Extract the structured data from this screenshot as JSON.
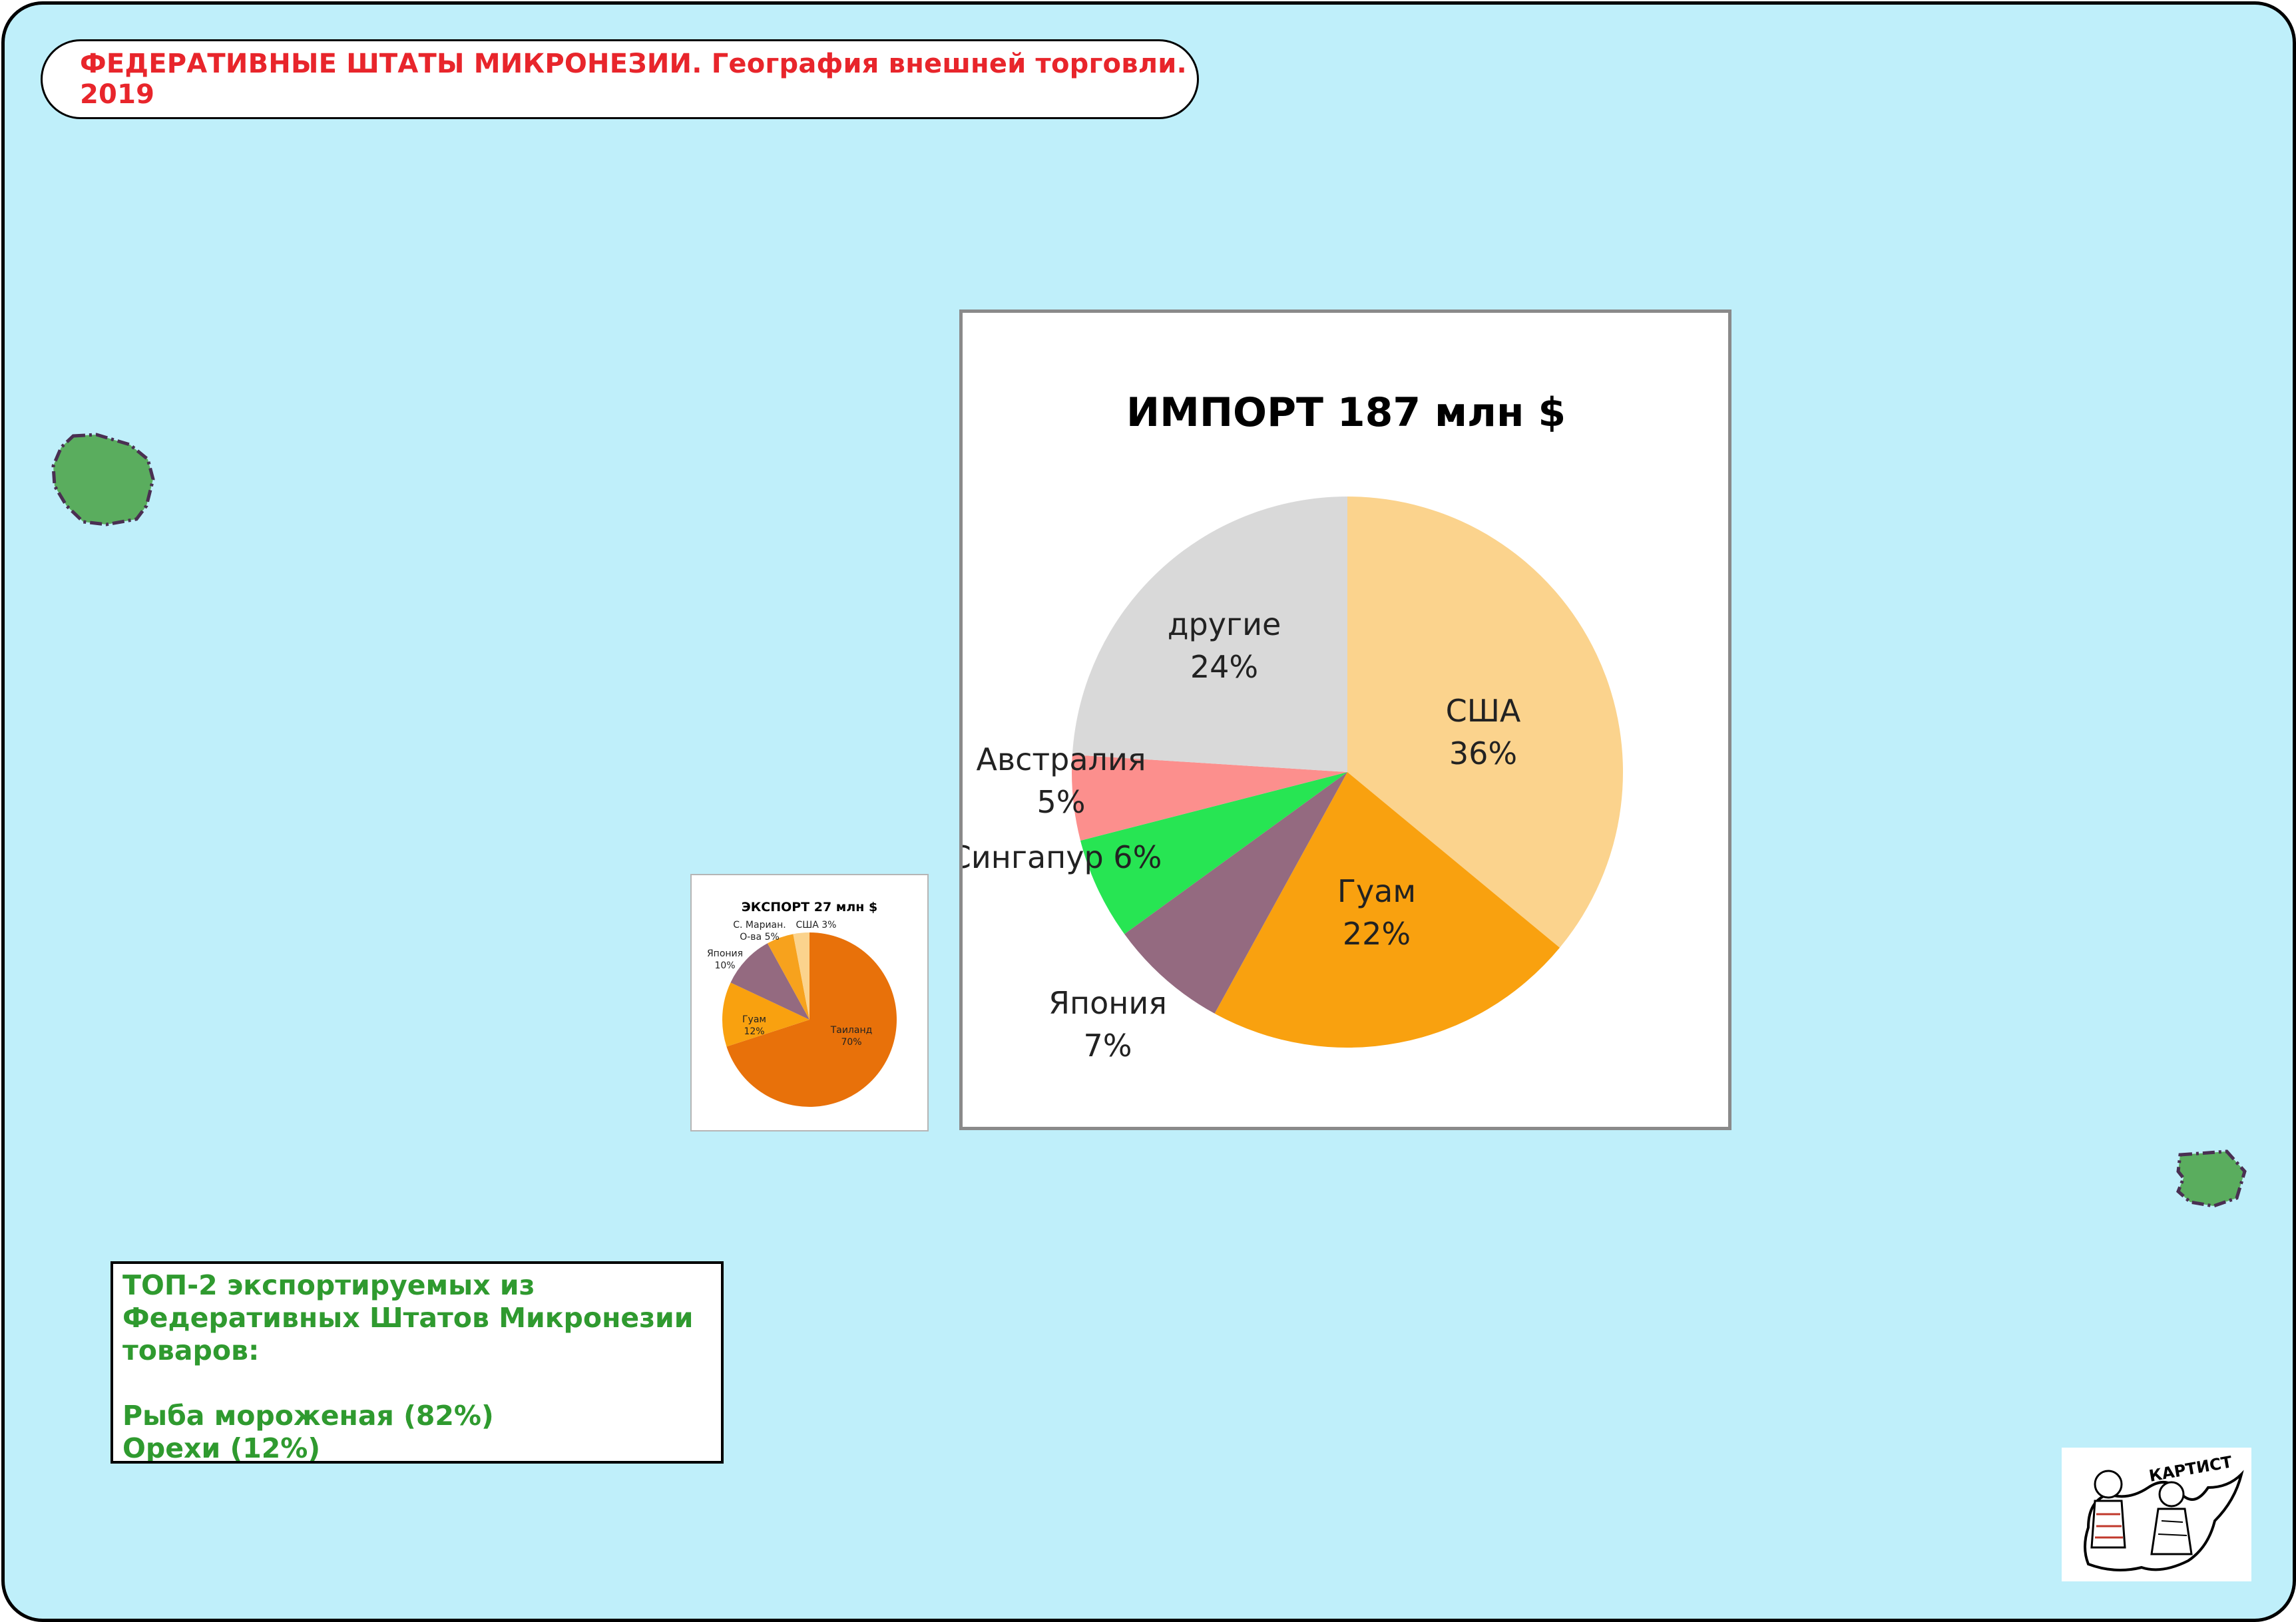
{
  "map_title": "ФЕДЕРАТИВНЫЕ ШТАТЫ МИКРОНЕЗИИ. География внешней торговли. 2019",
  "colors": {
    "ocean": "#bfeffa",
    "land": "#5aad5e",
    "title_text": "#e8252b",
    "list_text": "#2f9a2f"
  },
  "chart_data": [
    {
      "type": "pie",
      "title": "ИМПОРТ 187 млн $",
      "slices": [
        {
          "label": "США",
          "value": 36,
          "value_label": "36%",
          "color": "#fbd38d"
        },
        {
          "label": "Гуам",
          "value": 22,
          "value_label": "22%",
          "color": "#f9a10f"
        },
        {
          "label": "Япония",
          "value": 7,
          "value_label": "7%",
          "color": "#946a80"
        },
        {
          "label": "Сингапур",
          "value": 6,
          "value_label": "6%",
          "color": "#27e553"
        },
        {
          "label": "Австралия",
          "value": 5,
          "value_label": "5%",
          "color": "#fc8f8d"
        },
        {
          "label": "другие",
          "value": 24,
          "value_label": "24%",
          "color": "#d9d9d9"
        }
      ]
    },
    {
      "type": "pie",
      "title": "ЭКСПОРТ 27 млн $",
      "slices": [
        {
          "label": "Таиланд",
          "value": 70,
          "value_label": "70%",
          "color": "#e8710a"
        },
        {
          "label": "Гуам",
          "value": 12,
          "value_label": "12%",
          "color": "#f9a10f"
        },
        {
          "label": "Япония",
          "value": 10,
          "value_label": "10%",
          "color": "#946a80"
        },
        {
          "label": "С. Мариан. О-ва",
          "value": 5,
          "value_label": "5%",
          "color": "#f7a21d"
        },
        {
          "label": "США",
          "value": 3,
          "value_label": "3%",
          "color": "#fbd38d"
        }
      ]
    }
  ],
  "top_exports": {
    "heading": "ТОП-2 экспортируемых из Федеративных Штатов Микронезии товаров:",
    "heading_lines": [
      "ТОП-2 экспортируемых из",
      "Федеративных Штатов Микронезии",
      "товаров:"
    ],
    "items": [
      "Рыба мороженая (82%)",
      "Орехи (12%)"
    ]
  },
  "logo": {
    "text": "КАРТИСТ"
  }
}
